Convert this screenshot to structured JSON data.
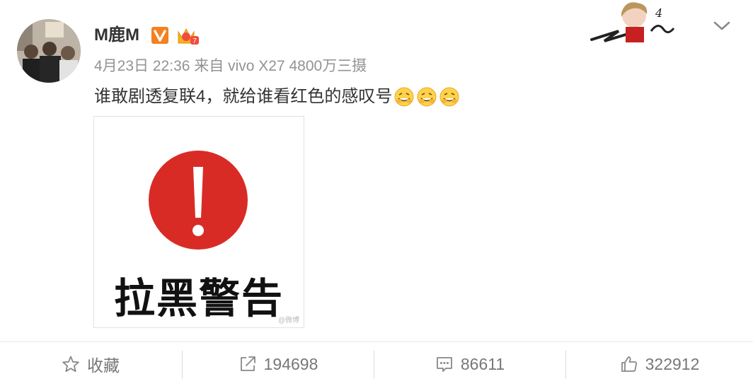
{
  "post": {
    "username": "M鹿M",
    "meta": "4月23日 22:36 来自 vivo X27 4800万三摄",
    "text": "谁敢剧透复联4，就给谁看红色的感叹号"
  },
  "image": {
    "caption": "拉黑警告",
    "watermark": "@微博"
  },
  "actions": {
    "favorite_label": "收藏",
    "repost_count": "194698",
    "comment_count": "86611",
    "like_count": "322912"
  },
  "colors": {
    "alert_red": "#d92b26",
    "vip_orange": "#f5801f",
    "text_gray": "#939393"
  },
  "icons": [
    "star-icon",
    "share-icon",
    "comment-icon",
    "thumbs-up-icon",
    "chevron-down-icon",
    "vip-v-icon",
    "crown-icon",
    "smiling-emoji-icon"
  ]
}
